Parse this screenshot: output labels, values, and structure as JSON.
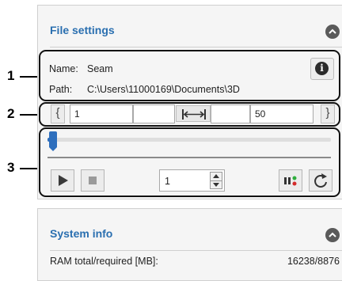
{
  "file_panel": {
    "title": "File settings",
    "name_label": "Name:",
    "name_value": "Seam",
    "path_label": "Path:",
    "path_value": "C:\\Users\\11000169\\Documents\\3D"
  },
  "range": {
    "start": "1",
    "end": "50",
    "prev_glyph": "{",
    "next_glyph": "}"
  },
  "playback": {
    "slider_position": 0.02,
    "step_value": "1"
  },
  "system_panel": {
    "title": "System info",
    "ram_label": "RAM total/required [MB]:",
    "ram_value": "16238/8876"
  },
  "callouts": [
    "1",
    "2",
    "3"
  ],
  "colors": {
    "accent": "#2e6fbd",
    "title_blue": "#2a6fb0",
    "panel_bg": "#f5f5f5",
    "status_green": "#2fae3d",
    "status_red": "#d32b2b"
  },
  "icons": {
    "collapse": "chevron-up-icon",
    "info": "info-icon",
    "fit_width": "fit-width-icon",
    "play": "play-icon",
    "stop": "stop-icon",
    "status": "status-dots-icon",
    "refresh": "refresh-icon"
  }
}
